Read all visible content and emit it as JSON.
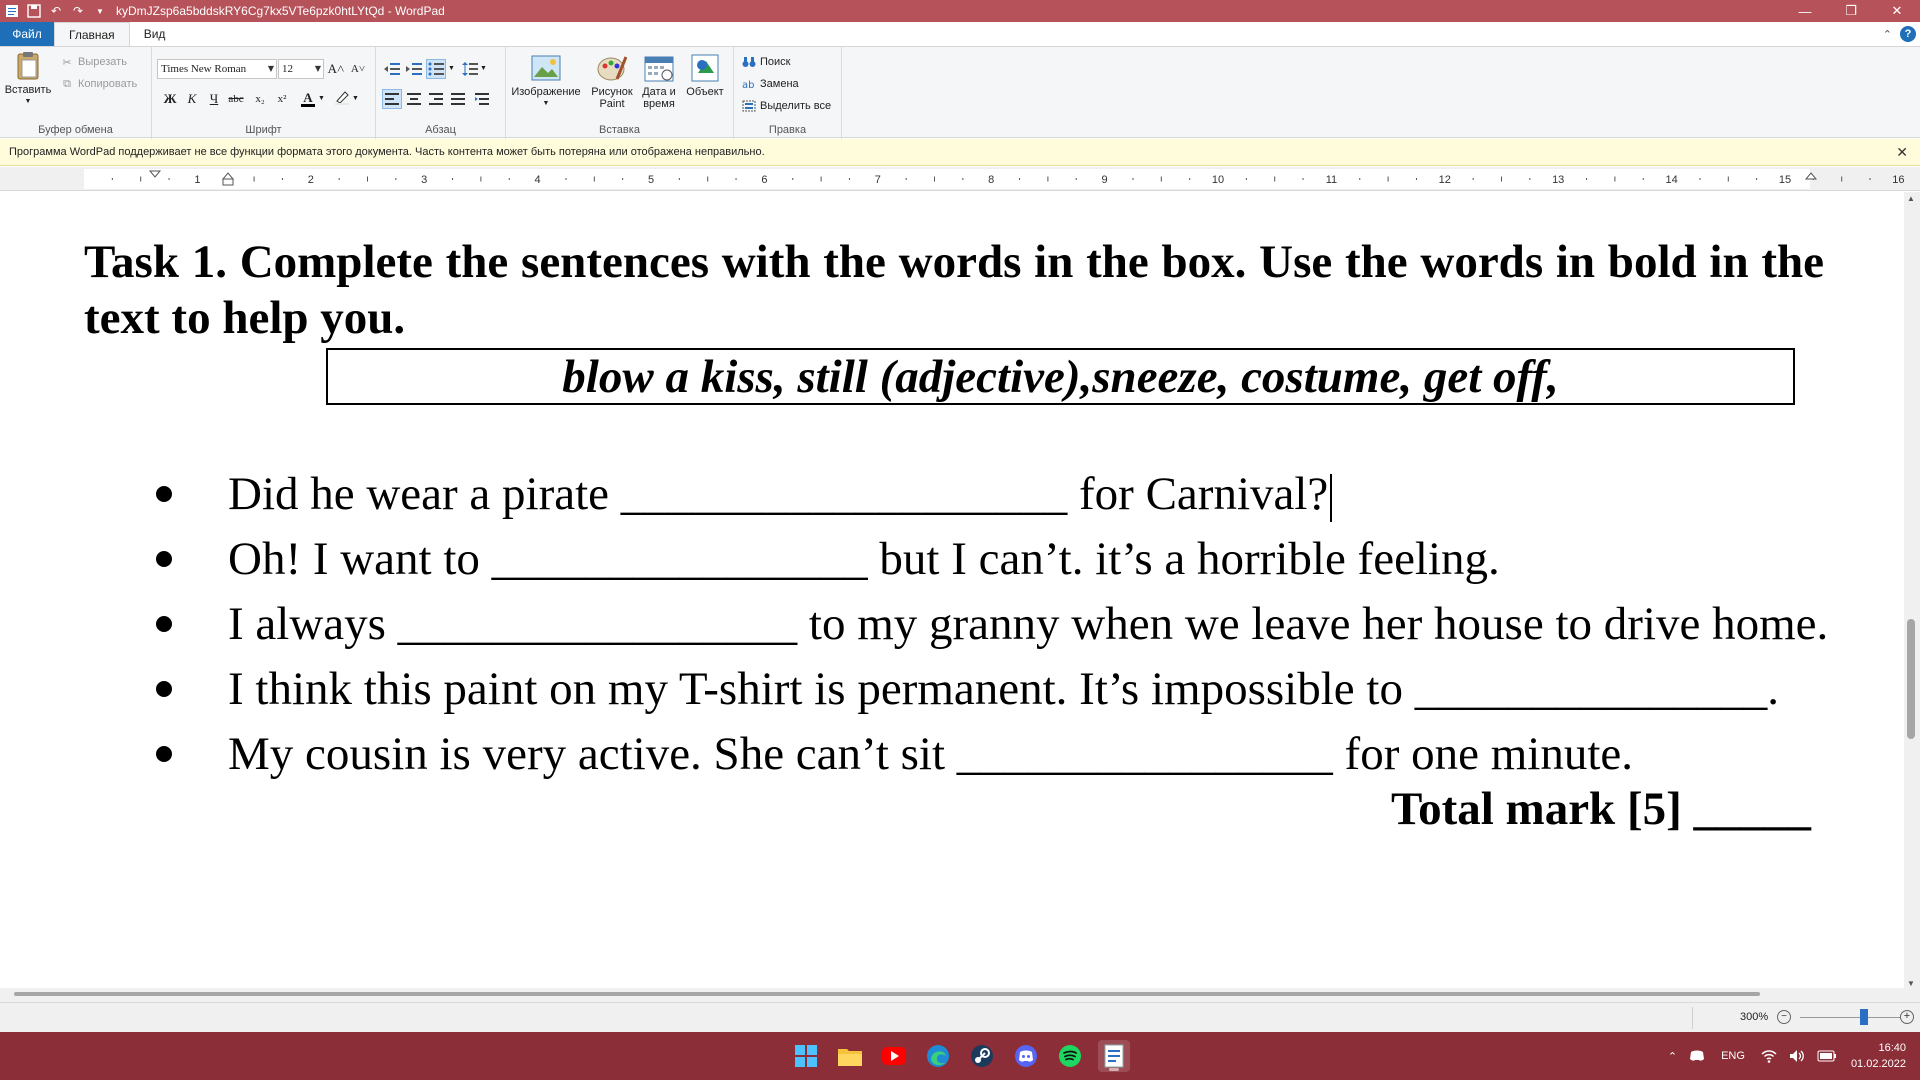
{
  "window": {
    "title": "kyDmJZsp6a5bddskRY6Cg7kx5VTe6pzk0htLYtQd - WordPad",
    "minimize": "—",
    "maximize": "❐",
    "close": "✕"
  },
  "ribbon_tabs": {
    "file": "Файл",
    "home": "Главная",
    "view": "Вид"
  },
  "clipboard": {
    "paste": "Вставить",
    "cut": "Вырезать",
    "copy": "Копировать",
    "label": "Буфер обмена"
  },
  "font": {
    "family": "Times New Roman",
    "size": "12",
    "label": "Шрифт",
    "bold": "Ж",
    "italic": "К",
    "underline": "Ч",
    "strike": "abc",
    "subscript": "x₂",
    "superscript": "x²",
    "grow": "A˄",
    "shrink": "A˅",
    "color_letter": "A"
  },
  "paragraph": {
    "label": "Абзац"
  },
  "insert": {
    "label": "Вставка",
    "image": "Изображение",
    "paint_line1": "Рисунок",
    "paint_line2": "Paint",
    "datetime_line1": "Дата и",
    "datetime_line2": "время",
    "object": "Объект"
  },
  "editing": {
    "label": "Правка",
    "find": "Поиск",
    "replace": "Замена",
    "select_all": "Выделить все"
  },
  "infobar": {
    "message": "Программа WordPad поддерживает не все функции формата этого документа. Часть контента может быть потеряна или отображена неправильно.",
    "close": "✕"
  },
  "ruler": {
    "numbers": [
      "1",
      "2",
      "3",
      "4",
      "5",
      "6",
      "7",
      "8",
      "9",
      "10",
      "11",
      "12",
      "13",
      "14",
      "15",
      "16"
    ]
  },
  "document": {
    "heading": "Task 1. Complete the sentences with the words in the box. Use the words in bold in the text to help you.",
    "word_box": "blow a kiss, still  (adjective),sneeze, costume, get off,",
    "sentences": [
      "Did he wear a pirate ___________________ for Carnival?",
      "Oh! I want to ________________ but I can’t. it’s a horrible feeling.",
      "I always _________________ to my granny when we leave her house to drive home.",
      "I think this paint on my T-shirt is permanent. It’s impossible to _______________.",
      "My cousin is very active. She can’t sit ________________ for one minute."
    ],
    "total_mark": "Total mark [5] _____"
  },
  "statusbar": {
    "zoom": "300%",
    "zoom_minus": "−",
    "zoom_plus": "+"
  },
  "taskbar": {
    "apps": [
      "start-icon",
      "file-explorer-icon",
      "youtube-icon",
      "edge-icon",
      "steam-icon",
      "discord-icon",
      "spotify-icon",
      "wordpad-icon"
    ],
    "tray": {
      "language": "ENG",
      "time": "16:40",
      "date": "01.02.2022"
    }
  },
  "colors": {
    "titlebar": "#b6535a",
    "taskbar": "#8b2e38",
    "file_tab": "#1e6fb8",
    "infobar": "#fffcdc"
  }
}
